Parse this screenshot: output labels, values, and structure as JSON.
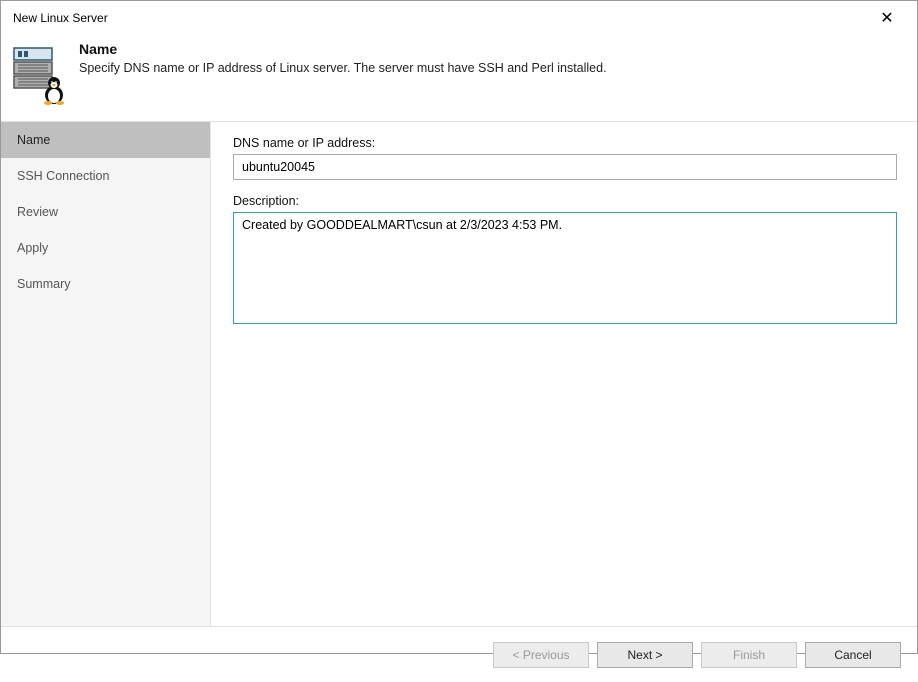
{
  "window": {
    "title": "New Linux Server"
  },
  "header": {
    "title": "Name",
    "subtitle": "Specify DNS name or IP address of Linux server. The server must have SSH and Perl installed."
  },
  "sidebar": {
    "items": [
      {
        "label": "Name",
        "active": true
      },
      {
        "label": "SSH Connection",
        "active": false
      },
      {
        "label": "Review",
        "active": false
      },
      {
        "label": "Apply",
        "active": false
      },
      {
        "label": "Summary",
        "active": false
      }
    ]
  },
  "form": {
    "dns_label": "DNS name or IP address:",
    "dns_value": "ubuntu20045",
    "description_label": "Description:",
    "description_value": "Created by GOODDEALMART\\csun at 2/3/2023 4:53 PM."
  },
  "footer": {
    "previous": "< Previous",
    "next": "Next >",
    "finish": "Finish",
    "cancel": "Cancel"
  }
}
